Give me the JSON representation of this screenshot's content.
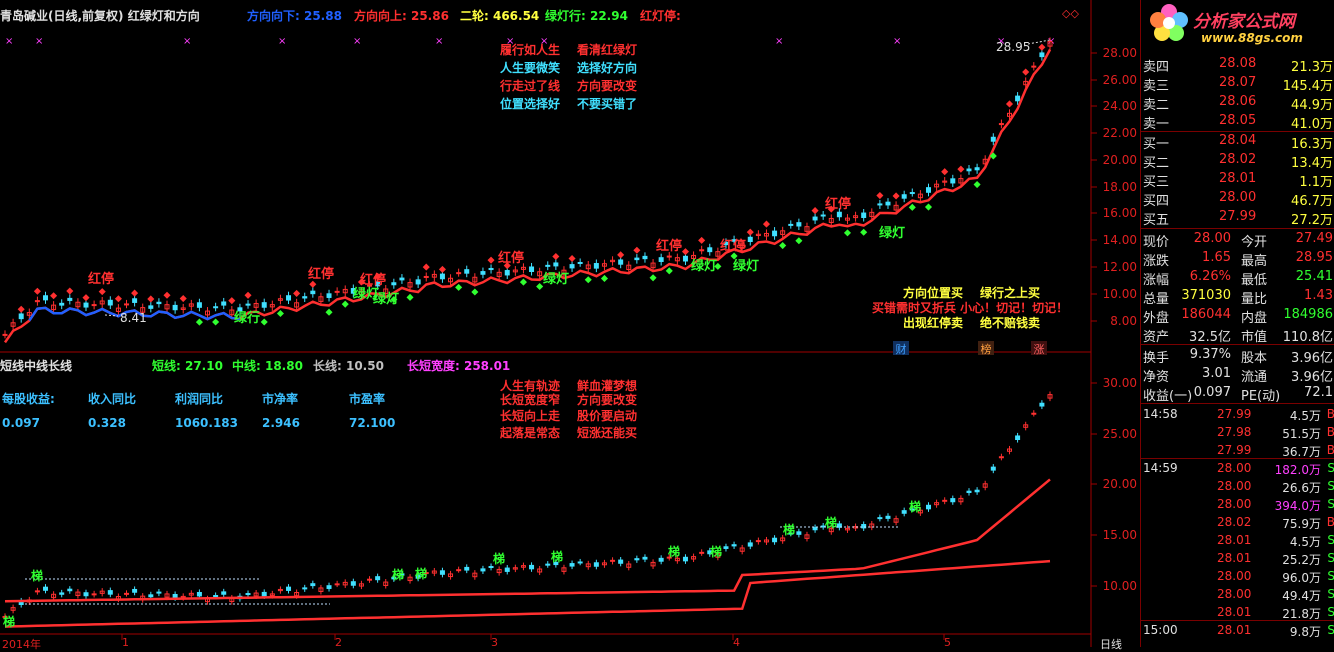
{
  "header": {
    "title": "青岛碱业(日线,前复权) 红绿灯和方向",
    "items": [
      {
        "label": "方向向下: 25.88",
        "color": "#2060ff"
      },
      {
        "label": "方向向上: 25.86",
        "color": "#ff3030"
      },
      {
        "label": "二轮: 466.54",
        "color": "#ffff40"
      },
      {
        "label": "绿灯行: 22.94",
        "color": "#30ff30"
      },
      {
        "label": "红灯停:",
        "color": "#ff3030"
      }
    ]
  },
  "upper_annotations": {
    "price_high": "28.95",
    "price_low": "8.41",
    "poem_left": [
      "履行如人生",
      "人生要微笑",
      "行走过了线",
      "位置选择好"
    ],
    "poem_right": [
      "看清红绿灯",
      "选择好方向",
      "方向要改变",
      "不要买错了"
    ],
    "tips_row1": [
      "方向位置买",
      "绿行之上买"
    ],
    "tips_row2": "买错需时又折兵  小心！切记！切记！",
    "tips_row3": [
      "出现红停卖",
      "绝不赔钱卖"
    ],
    "red_stop": "红停",
    "green_go": "绿灯",
    "green_go2": "绿行",
    "markers": [
      "财",
      "榜",
      "涨"
    ]
  },
  "lower_header": {
    "title": "短线中线长线",
    "items": [
      {
        "label": "短线: 27.10",
        "color": "#30ff30"
      },
      {
        "label": "中线: 18.80",
        "color": "#30ff30"
      },
      {
        "label": "长线: 10.50",
        "color": "#c0c0c0"
      },
      {
        "label": "长短宽度: 258.01",
        "color": "#ff40ff"
      }
    ]
  },
  "lower_annotations": {
    "poem_left": [
      "人生有轨迹",
      "长短宽度窄",
      "长短向上走",
      "起落是常态"
    ],
    "poem_right": [
      "鲜血灌梦想",
      "方向要改变",
      "股价要启动",
      "短涨还能买"
    ],
    "fin_labels": [
      "每股收益:",
      "收入同比",
      "利润同比",
      "市净率",
      "市盈率"
    ],
    "fin_values": [
      "0.097",
      "0.328",
      "1060.183",
      "2.946",
      "72.100"
    ],
    "tag": "梯"
  },
  "upper_yaxis": [
    "28.00",
    "26.00",
    "24.00",
    "22.00",
    "20.00",
    "18.00",
    "16.00",
    "14.00",
    "12.00",
    "10.00",
    "8.00"
  ],
  "lower_yaxis": [
    "30.00",
    "25.00",
    "20.00",
    "15.00",
    "10.00"
  ],
  "xaxis": {
    "year": "2014年",
    "months": [
      "1",
      "2",
      "3",
      "4",
      "5"
    ],
    "period": "日线"
  },
  "right_panel": {
    "logo_text": "分析家公式网",
    "logo_url": "www.88gs.com",
    "asks": [
      {
        "label": "卖四",
        "price": "28.08",
        "vol": "21.3万"
      },
      {
        "label": "卖三",
        "price": "28.07",
        "vol": "145.4万"
      },
      {
        "label": "卖二",
        "price": "28.06",
        "vol": "44.9万"
      },
      {
        "label": "卖一",
        "price": "28.05",
        "vol": "41.0万"
      }
    ],
    "bids": [
      {
        "label": "买一",
        "price": "28.04",
        "vol": "16.3万"
      },
      {
        "label": "买二",
        "price": "28.02",
        "vol": "13.4万"
      },
      {
        "label": "买三",
        "price": "28.01",
        "vol": "1.1万"
      },
      {
        "label": "买四",
        "price": "28.00",
        "vol": "46.7万"
      },
      {
        "label": "买五",
        "price": "27.99",
        "vol": "27.2万"
      }
    ],
    "info": [
      {
        "l1": "现价",
        "v1": "28.00",
        "c1": "#ff3030",
        "l2": "今开",
        "v2": "27.49",
        "c2": "#ff3030"
      },
      {
        "l1": "涨跌",
        "v1": "1.65",
        "c1": "#ff3030",
        "l2": "最高",
        "v2": "28.95",
        "c2": "#ff3030"
      },
      {
        "l1": "涨幅",
        "v1": "6.26%",
        "c1": "#ff3030",
        "l2": "最低",
        "v2": "25.41",
        "c2": "#30ff30"
      },
      {
        "l1": "总量",
        "v1": "371030",
        "c1": "#ffff40",
        "l2": "量比",
        "v2": "1.43",
        "c2": "#ff3030"
      },
      {
        "l1": "外盘",
        "v1": "186044",
        "c1": "#ff3030",
        "l2": "内盘",
        "v2": "184986",
        "c2": "#30ff30"
      },
      {
        "l1": "资产",
        "v1": "32.5亿",
        "c1": "#e0e0e0",
        "l2": "市值",
        "v2": "110.8亿",
        "c2": "#e0e0e0"
      },
      {
        "l1": "换手",
        "v1": "9.37%",
        "c1": "#e0e0e0",
        "l2": "股本",
        "v2": "3.96亿",
        "c2": "#e0e0e0"
      },
      {
        "l1": "净资",
        "v1": "3.01",
        "c1": "#e0e0e0",
        "l2": "流通",
        "v2": "3.96亿",
        "c2": "#e0e0e0"
      },
      {
        "l1": "收益(一)",
        "v1": "0.097",
        "c1": "#e0e0e0",
        "l2": "PE(动)",
        "v2": "72.1",
        "c2": "#e0e0e0"
      }
    ],
    "ticks": [
      {
        "time": "14:58",
        "price": "27.99",
        "vol": "4.5万",
        "vc": "#e0e0e0",
        "dir": "B"
      },
      {
        "time": "",
        "price": "27.98",
        "vol": "51.5万",
        "vc": "#e0e0e0",
        "dir": "B"
      },
      {
        "time": "",
        "price": "27.99",
        "vol": "36.7万",
        "vc": "#e0e0e0",
        "dir": "B"
      },
      {
        "time": "14:59",
        "price": "28.00",
        "vol": "182.0万",
        "vc": "#ff40ff",
        "dir": "S"
      },
      {
        "time": "",
        "price": "28.00",
        "vol": "26.6万",
        "vc": "#e0e0e0",
        "dir": "S"
      },
      {
        "time": "",
        "price": "28.00",
        "vol": "394.0万",
        "vc": "#ff40ff",
        "dir": "S"
      },
      {
        "time": "",
        "price": "28.02",
        "vol": "75.9万",
        "vc": "#e0e0e0",
        "dir": "B"
      },
      {
        "time": "",
        "price": "28.01",
        "vol": "4.5万",
        "vc": "#e0e0e0",
        "dir": "S"
      },
      {
        "time": "",
        "price": "28.01",
        "vol": "25.2万",
        "vc": "#e0e0e0",
        "dir": "S"
      },
      {
        "time": "",
        "price": "28.00",
        "vol": "96.0万",
        "vc": "#e0e0e0",
        "dir": "S"
      },
      {
        "time": "",
        "price": "28.00",
        "vol": "49.4万",
        "vc": "#e0e0e0",
        "dir": "S"
      },
      {
        "time": "",
        "price": "28.01",
        "vol": "21.8万",
        "vc": "#e0e0e0",
        "dir": "S"
      },
      {
        "time": "15:00",
        "price": "28.01",
        "vol": "9.8万",
        "vc": "#e0e0e0",
        "dir": "S"
      }
    ]
  },
  "colors": {
    "red": "#ff3030",
    "green": "#30ff30",
    "cyan": "#40e0ff",
    "blue": "#2060ff",
    "yellow": "#ffff40",
    "magenta": "#ff40ff",
    "axis": "#a00000"
  }
}
